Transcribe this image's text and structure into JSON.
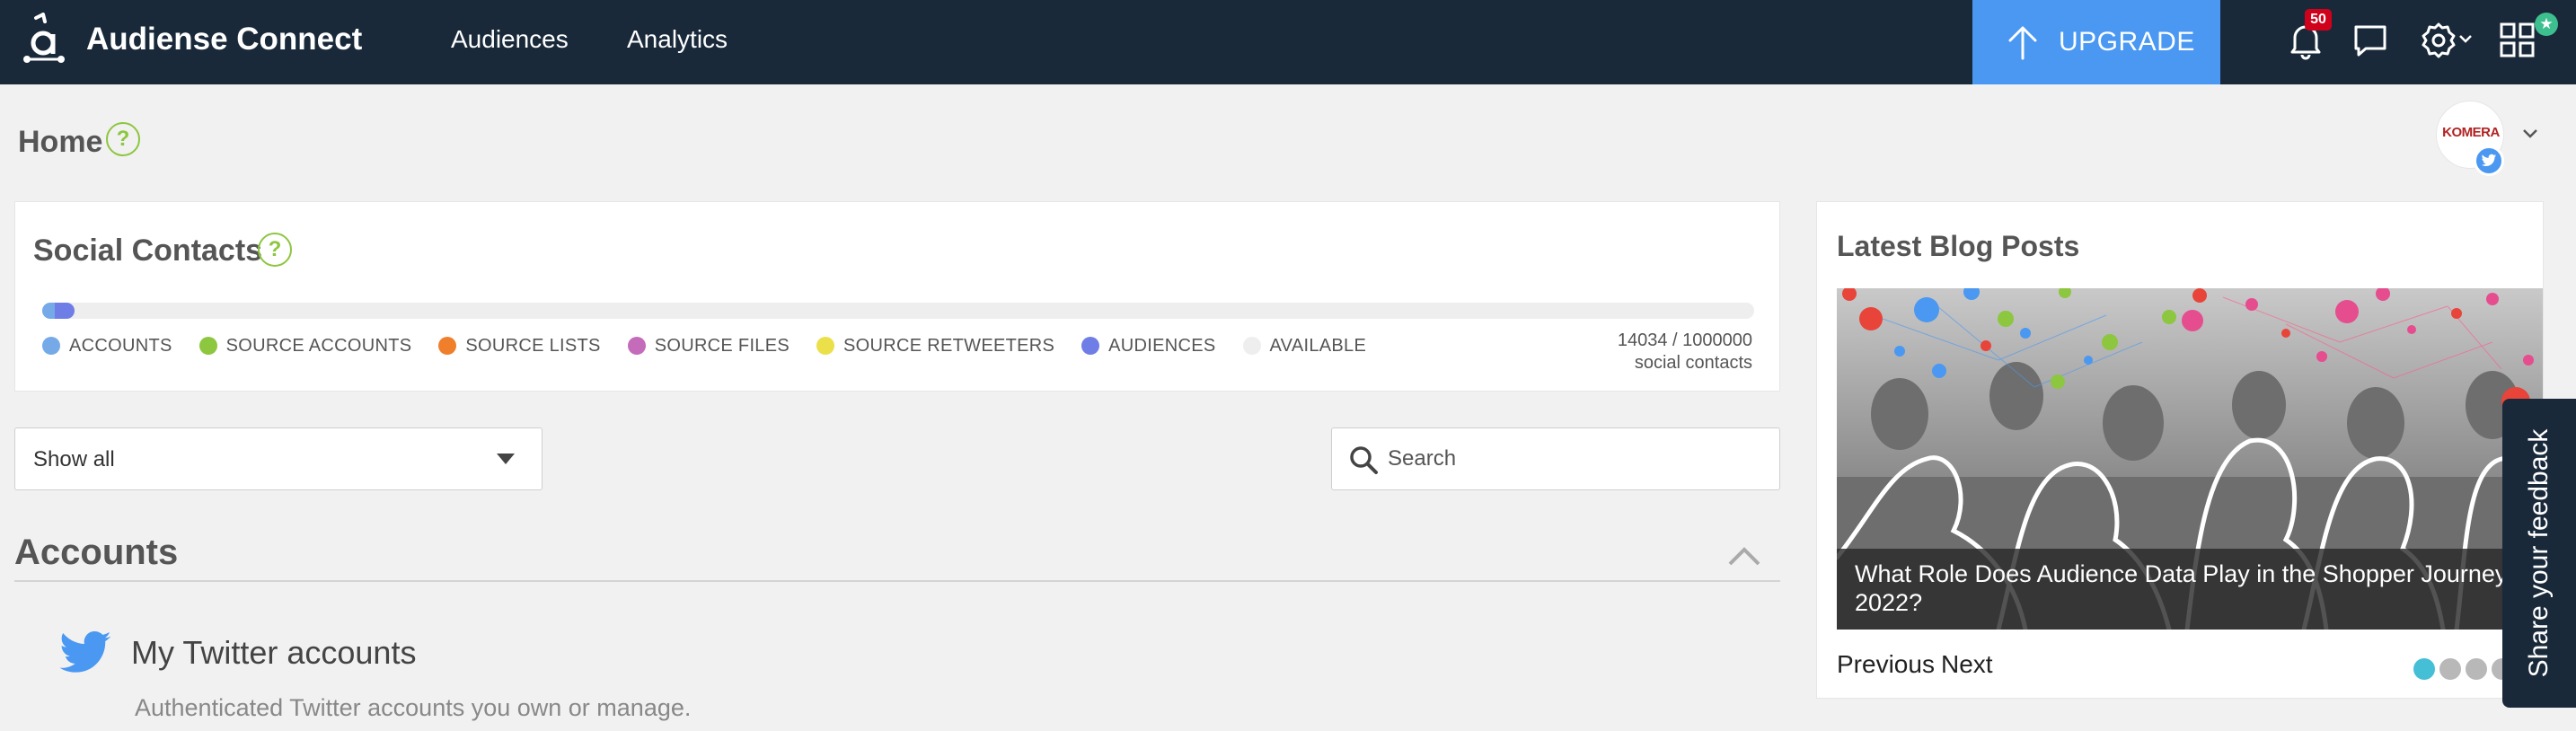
{
  "app": {
    "brand": "Audiense Connect"
  },
  "nav": {
    "items": [
      {
        "label": "Audiences"
      },
      {
        "label": "Analytics"
      }
    ],
    "upgrade_label": "UPGRADE",
    "notification_count": "50"
  },
  "page": {
    "title": "Home",
    "help_glyph": "?"
  },
  "account": {
    "avatar_text": "KOMERA"
  },
  "social_contacts": {
    "title": "Social Contacts",
    "used": 14034,
    "total": 1000000,
    "total_text": "14034 / 1000000",
    "unit_label": "social contacts",
    "legend": [
      {
        "label": "ACCOUNTS",
        "color": "#75a9e8"
      },
      {
        "label": "SOURCE ACCOUNTS",
        "color": "#8dc63f"
      },
      {
        "label": "SOURCE LISTS",
        "color": "#f07f2b"
      },
      {
        "label": "SOURCE FILES",
        "color": "#c46bba"
      },
      {
        "label": "SOURCE RETWEETERS",
        "color": "#ebe04a"
      },
      {
        "label": "AUDIENCES",
        "color": "#6f7de6"
      },
      {
        "label": "AVAILABLE",
        "color": "#eeeeee"
      }
    ]
  },
  "filter": {
    "selected": "Show all"
  },
  "search": {
    "placeholder": "Search"
  },
  "accounts": {
    "title": "Accounts",
    "twitter_title": "My Twitter accounts",
    "twitter_subtitle": "Authenticated Twitter accounts you own or manage."
  },
  "blog": {
    "title": "Latest Blog Posts",
    "post_title": "What Role Does Audience Data Play in the Shopper Journey\n2022?",
    "prev_label": "Previous",
    "next_label": "Next",
    "slide_count": 4,
    "active_slide": 1
  },
  "feedback": {
    "label": "Share your feedback"
  },
  "colors": {
    "topbar": "#19293a",
    "upgrade": "#4a98f1",
    "help": "#8dc63f",
    "twitter": "#4a98f1"
  },
  "icons": [
    "audiense-logo-icon",
    "arrow-up-icon",
    "bell-icon",
    "chat-bubble-icon",
    "gear-icon",
    "apps-grid-icon",
    "star-icon",
    "twitter-bird-icon",
    "search-icon",
    "chevron-down-icon",
    "chevron-up-icon"
  ]
}
